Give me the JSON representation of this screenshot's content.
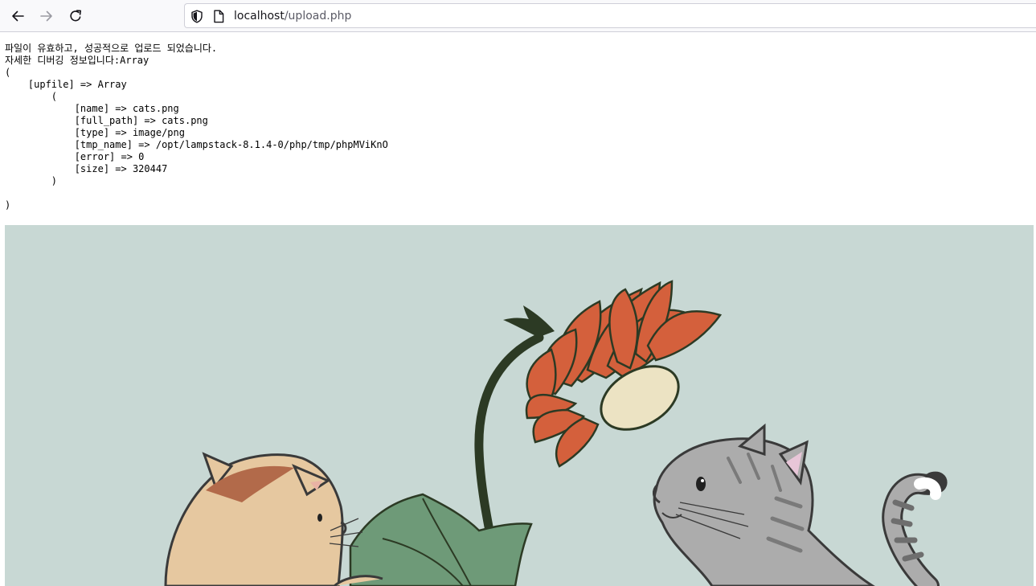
{
  "browser": {
    "url_host": "localhost",
    "url_path": "/upload.php"
  },
  "page": {
    "status_message": "파일이 유효하고, 성공적으로 업로드 되었습니다.",
    "debug_prefix": "자세한 디버깅 정보입니다:Array",
    "debug_lines": [
      "(",
      "    [upfile] => Array",
      "        (",
      "            [name] => cats.png",
      "            [full_path] => cats.png",
      "            [type] => image/png",
      "            [tmp_name] => /opt/lampstack-8.1.4-0/php/tmp/phpMViKnO",
      "            [error] => 0",
      "            [size] => 320447",
      "        )",
      "",
      ")"
    ]
  },
  "image": {
    "background_color": "#c8d8d4"
  },
  "icons": {
    "back": "arrow-left",
    "forward": "arrow-right",
    "reload": "reload",
    "shield": "tracking-protection-shield",
    "page": "page-document"
  }
}
